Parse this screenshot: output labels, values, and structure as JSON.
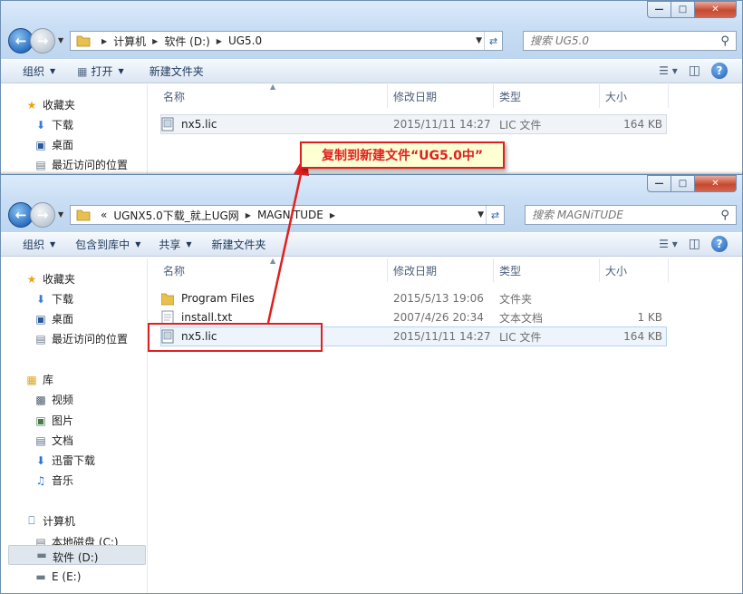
{
  "back_window": {
    "address": {
      "crumbs": [
        "计算机",
        "软件 (D:)",
        "UG5.0"
      ]
    },
    "search_placeholder": "搜索 UG5.0",
    "toolbar": {
      "organize": "组织",
      "open": "打开",
      "new_folder": "新建文件夹"
    },
    "nav": [
      {
        "label": "收藏夹",
        "icon": "star-icon"
      },
      {
        "label": "下载",
        "icon": "download-folder-icon"
      },
      {
        "label": "桌面",
        "icon": "desktop-icon"
      },
      {
        "label": "最近访问的位置",
        "icon": "recent-places-icon"
      }
    ],
    "columns": {
      "name": "名称",
      "modified": "修改日期",
      "type": "类型",
      "size": "大小"
    },
    "files": [
      {
        "name": "nx5.lic",
        "modified": "2015/11/11 14:27",
        "type": "LIC 文件",
        "size": "164 KB",
        "icon": "license-file-icon"
      }
    ]
  },
  "front_window": {
    "address": {
      "crumbs": [
        "«",
        "UGNX5.0下载_就上UG网",
        "MAGNiTUDE"
      ]
    },
    "search_placeholder": "搜索 MAGNiTUDE",
    "toolbar": {
      "organize": "组织",
      "include_in_library": "包含到库中",
      "share": "共享",
      "new_folder": "新建文件夹"
    },
    "nav": {
      "favorites": [
        {
          "label": "收藏夹",
          "icon": "star-icon"
        },
        {
          "label": "下载",
          "icon": "download-folder-icon"
        },
        {
          "label": "桌面",
          "icon": "desktop-icon"
        },
        {
          "label": "最近访问的位置",
          "icon": "recent-places-icon"
        }
      ],
      "libraries": [
        {
          "label": "库",
          "icon": "library-icon"
        },
        {
          "label": "视频",
          "icon": "video-icon"
        },
        {
          "label": "图片",
          "icon": "pictures-icon"
        },
        {
          "label": "文档",
          "icon": "documents-icon"
        },
        {
          "label": "迅雷下载",
          "icon": "thunder-download-icon"
        },
        {
          "label": "音乐",
          "icon": "music-icon"
        }
      ],
      "computer": [
        {
          "label": "计算机",
          "icon": "computer-icon"
        },
        {
          "label": "本地磁盘 (C:)",
          "icon": "system-drive-icon"
        },
        {
          "label": "软件 (D:)",
          "icon": "drive-icon"
        },
        {
          "label": "E (E:)",
          "icon": "drive-icon"
        }
      ]
    },
    "columns": {
      "name": "名称",
      "modified": "修改日期",
      "type": "类型",
      "size": "大小"
    },
    "files": [
      {
        "name": "Program Files",
        "modified": "2015/5/13 19:06",
        "type": "文件夹",
        "size": "",
        "icon": "folder-icon"
      },
      {
        "name": "install.txt",
        "modified": "2007/4/26 20:34",
        "type": "文本文档",
        "size": "1 KB",
        "icon": "text-file-icon"
      },
      {
        "name": "nx5.lic",
        "modified": "2015/11/11 14:27",
        "type": "LIC 文件",
        "size": "164 KB",
        "icon": "license-file-icon"
      }
    ]
  },
  "annotation": {
    "label": "复制到新建文件“UG5.0中”",
    "color": "#e0201f"
  }
}
